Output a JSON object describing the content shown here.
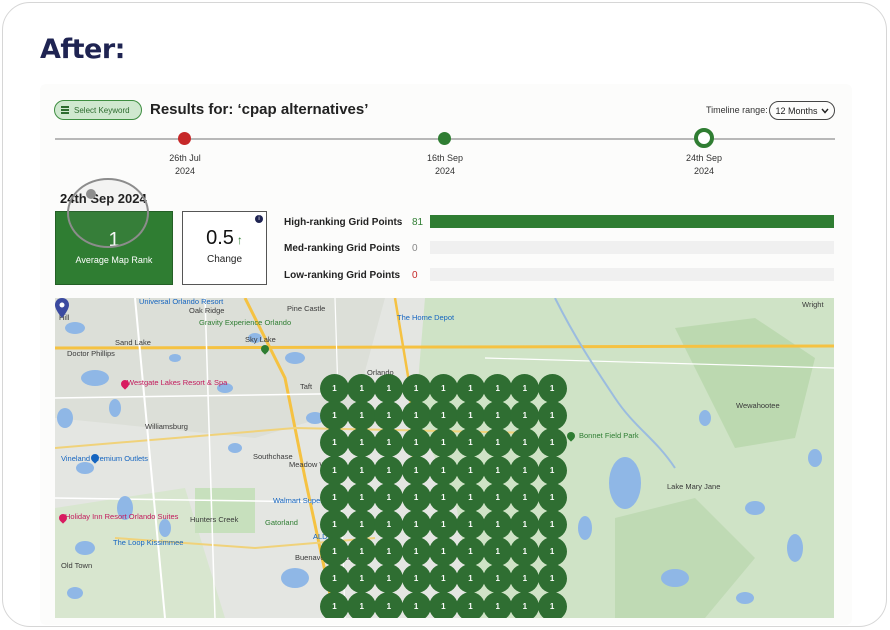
{
  "heading": "After:",
  "toolbar": {
    "select_keyword_label": "Select Keyword",
    "results_title": "Results for: ‘cpap alternatives’",
    "timeline_range_label": "Timeline range:",
    "timeline_range_value": "12 Months"
  },
  "timeline": {
    "points": [
      {
        "date": "26th Jul",
        "year": "2024",
        "state": "red"
      },
      {
        "date": "16th Sep",
        "year": "2024",
        "state": "green"
      },
      {
        "date": "24th Sep",
        "year": "2024",
        "state": "selected"
      }
    ]
  },
  "summary": {
    "date": "24th Sep 2024",
    "average_map_rank": {
      "value": "1",
      "label": "Average Map Rank"
    },
    "change": {
      "value": "0.5",
      "label": "Change",
      "direction": "up"
    }
  },
  "grid_points": [
    {
      "label": "High-ranking Grid Points",
      "value": "81",
      "fraction": 1.0
    },
    {
      "label": "Med-ranking Grid Points",
      "value": "0",
      "fraction": 0
    },
    {
      "label": "Low-ranking Grid Points",
      "value": "0",
      "fraction": 0
    }
  ],
  "map": {
    "labels": {
      "dr_phillips": "Doctor Phillips",
      "williamsburg": "Williamsburg",
      "sand_lake": "Sand Lake",
      "sky_lake": "Sky Lake",
      "oak_ridge": "Oak Ridge",
      "taft": "Taft",
      "southchase": "Southchase",
      "meadow_woods": "Meadow Woods",
      "hunters_creek": "Hunters Creek",
      "buenaventura": "Buenaventura Lakes",
      "old_town": "Old Town",
      "lake_mary_jane": "Lake Mary Jane",
      "wewahootee": "Wewahootee",
      "bonnet_field_park": "Bonnet Field Park",
      "pine_castle": "Pine Castle",
      "home_depot": "The Home Depot",
      "westgate": "Westgate Lakes Resort & Spa",
      "gatorland": "Gatorland",
      "walmart": "Walmart Supercenter",
      "loop": "The Loop Kissimmee",
      "holiday_inn": "Holiday Inn Resort Orlando Suites",
      "universal": "Universal Orlando Resort",
      "gravity": "Gravity Experience Orlando",
      "hill": "Hill",
      "vineland": "Vineland Premium Outlets",
      "aldi": "ALDI",
      "wright": "Wright",
      "orlando": "Orlando"
    },
    "grid_value": "1",
    "grid_rows": 9,
    "grid_cols": 9
  },
  "colors": {
    "brand_green": "#2f7d32",
    "navy": "#1f2452",
    "timeline_red": "#c62828"
  }
}
